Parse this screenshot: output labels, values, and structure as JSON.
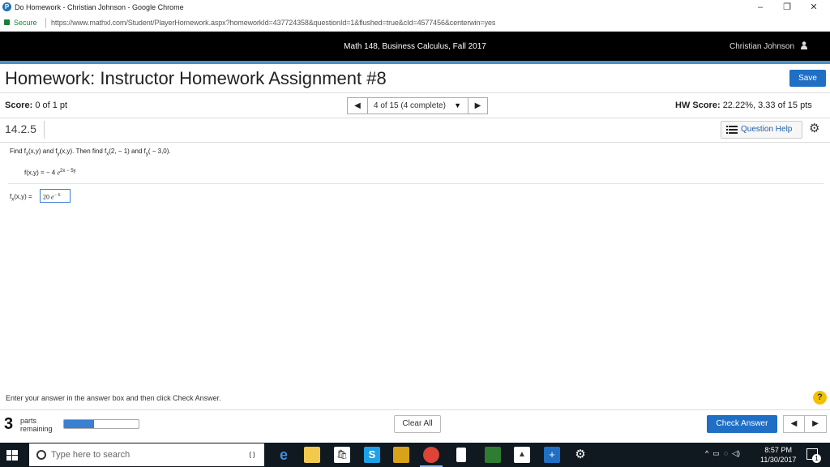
{
  "window": {
    "title": "Do Homework - Christian Johnson - Google Chrome",
    "minimize": "–",
    "restore": "❐",
    "close": "✕"
  },
  "address": {
    "secure_label": "Secure",
    "url": "https://www.mathxl.com/Student/PlayerHomework.aspx?homeworkId=437724358&questionId=1&flushed=true&cId=4577456&centerwin=yes"
  },
  "course": {
    "name": "Math 148, Business Calculus, Fall 2017",
    "user": "Christian Johnson"
  },
  "homework": {
    "title": "Homework: Instructor Homework Assignment #8",
    "save_label": "Save"
  },
  "score": {
    "label": "Score:",
    "value": "0 of 1 pt",
    "nav_select": "4 of 15 (4 complete)",
    "hw_label": "HW Score:",
    "hw_value": "22.22%, 3.33 of 15 pts"
  },
  "question": {
    "number": "14.2.5",
    "help_label": "Question Help",
    "prompt_parts": {
      "find": "Find f",
      "sub_x": "x",
      "xy": "(x,y) and f",
      "sub_y": "y",
      "xy2": "(x,y). Then find f",
      "sub_x2": "x",
      "pt1": "(2, − 1) and f",
      "sub_y2": "y",
      "pt2": "( − 3,0)."
    },
    "function": {
      "lhs": "f(x,y) = − 4",
      "base": "e",
      "exponent": "2x − 5y"
    },
    "answer": {
      "label_f": "f",
      "label_sub": "x",
      "label_rest": "(x,y) =",
      "value_coef": "20",
      "value_base": "e",
      "value_exp": "− 6"
    }
  },
  "footer": {
    "instruction": "Enter your answer in the answer box and then click Check Answer.",
    "help_glyph": "?",
    "parts_count": "3",
    "parts_label_1": "parts",
    "parts_label_2": "remaining",
    "progress_fraction": 0.4,
    "clear_all": "Clear All",
    "check_answer": "Check Answer"
  },
  "taskbar": {
    "search_placeholder": "Type here to search",
    "time": "8:57 PM",
    "date": "11/30/2017",
    "notification_count": "1"
  },
  "colors": {
    "accent": "#1f6fc5",
    "header_bg": "#000000",
    "blue_rule": "#4a90c8"
  }
}
